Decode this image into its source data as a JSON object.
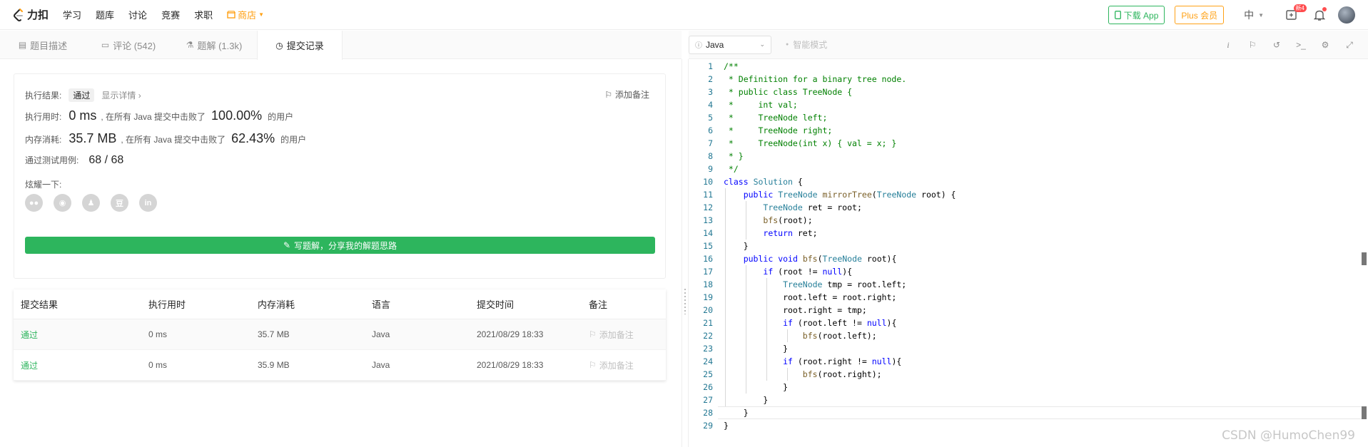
{
  "topnav": {
    "logo": "力扣",
    "items": [
      "学习",
      "题库",
      "讨论",
      "竞赛",
      "求职"
    ],
    "shop": "商店",
    "download_app": "下载 App",
    "plus": "Plus 会员",
    "language": "中",
    "badge": "新4"
  },
  "tabs": [
    {
      "label": "题目描述",
      "icon": "description-icon"
    },
    {
      "label": "评论 (542)",
      "icon": "comment-icon"
    },
    {
      "label": "题解 (1.3k)",
      "icon": "flask-icon"
    },
    {
      "label": "提交记录",
      "icon": "clock-icon",
      "active": true
    }
  ],
  "result": {
    "result_label": "执行结果:",
    "status": "通过",
    "detail": "显示详情 ›",
    "add_note": "添加备注",
    "time_label": "执行用时:",
    "time_value": "0 ms",
    "time_mid": ", 在所有 Java 提交中击败了",
    "time_pct": "100.00%",
    "time_tail": "的用户",
    "mem_label": "内存消耗:",
    "mem_value": "35.7 MB",
    "mem_mid": ", 在所有 Java 提交中击败了",
    "mem_pct": "62.43%",
    "mem_tail": "的用户",
    "tests_label": "通过测试用例:",
    "tests_value": "68 / 68",
    "share_label": "炫耀一下:",
    "share_icons": [
      "wechat-icon",
      "weibo-icon",
      "qq-icon",
      "douban-icon",
      "linkedin-icon"
    ],
    "write_button": "写题解，分享我的解题思路"
  },
  "submissions": {
    "headers": [
      "提交结果",
      "执行用时",
      "内存消耗",
      "语言",
      "提交时间",
      "备注"
    ],
    "rows": [
      {
        "status": "通过",
        "time": "0 ms",
        "memory": "35.7 MB",
        "lang": "Java",
        "submitted": "2021/08/29 18:33",
        "note": "添加备注"
      },
      {
        "status": "通过",
        "time": "0 ms",
        "memory": "35.9 MB",
        "lang": "Java",
        "submitted": "2021/08/29 18:33",
        "note": "添加备注"
      }
    ]
  },
  "editor": {
    "language": "Java",
    "smart_mode": "智能模式",
    "lines": [
      "/**",
      " * Definition for a binary tree node.",
      " * public class TreeNode {",
      " *     int val;",
      " *     TreeNode left;",
      " *     TreeNode right;",
      " *     TreeNode(int x) { val = x; }",
      " * }",
      " */",
      "class Solution {",
      "    public TreeNode mirrorTree(TreeNode root) {",
      "        TreeNode ret = root;",
      "        bfs(root);",
      "        return ret;",
      "    }",
      "    public void bfs(TreeNode root){",
      "        if (root != null){",
      "            TreeNode tmp = root.left;",
      "            root.left = root.right;",
      "            root.right = tmp;",
      "            if (root.left != null){",
      "                bfs(root.left);",
      "            }",
      "            if (root.right != null){",
      "                bfs(root.right);",
      "            }",
      "        }",
      "    }",
      "}"
    ]
  },
  "watermark": "CSDN @HumoChen99"
}
